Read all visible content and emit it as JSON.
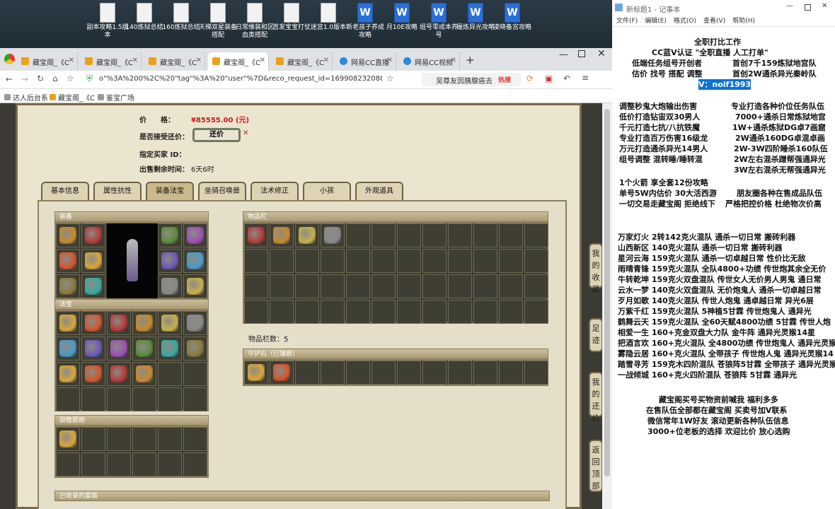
{
  "desktop": {
    "icons": [
      {
        "label": "副本攻略1.5版本",
        "type": "txt"
      },
      {
        "label": "140炼狱总结",
        "type": "txt"
      },
      {
        "label": "160炼狱总结",
        "type": "txt"
      },
      {
        "label": "天梯双星装备搭配",
        "type": "txt"
      },
      {
        "label": "日常维装和区血类搭配",
        "type": "txt"
      },
      {
        "label": "首发宝宝打仗",
        "type": "txt"
      },
      {
        "label": "迷宫1.0版本",
        "type": "txt"
      },
      {
        "label": "新老孩子养成攻略",
        "type": "word"
      },
      {
        "label": "月10E攻略",
        "type": "word"
      },
      {
        "label": "组号零成本养号",
        "type": "word"
      },
      {
        "label": "履炼异光攻略",
        "type": "word"
      },
      {
        "label": "凌晓备宫攻略",
        "type": "word"
      }
    ]
  },
  "browser": {
    "tabs": [
      "藏宝阁_《C",
      "藏宝阁_《C",
      "藏宝阁_《C",
      "藏宝阁_《C",
      "藏宝阁_《C",
      "网易CC直播",
      "网易CC视频"
    ],
    "url": "o\"%3A%200%2C%20\"tag\"%3A%20\"user\"%7D&reco_request_id=1699082320880wCScv",
    "search_text": "吴尊友因胰腺癌去",
    "search_hot": "热搜",
    "bookmarks": [
      "达人后台系",
      "藏宝阁_《C",
      "鉴宝广场"
    ]
  },
  "game": {
    "price_label": "价　　格：",
    "price_value": "¥85555.00 (元)",
    "bargain_label": "是否接受还价：",
    "bargain_button": "还价",
    "buyer_label": "指定买家 ID：",
    "time_label": "出售剩余时间：",
    "time_value": "6天6时",
    "tabs": [
      "基本信息",
      "属性抗性",
      "装备法宝",
      "坐骑召唤兽",
      "法术修正",
      "小孩",
      "外观道具"
    ],
    "equip_title": "装备",
    "fabao_title": "法宝",
    "badge_title": "勋敬层册",
    "bag_title": "物品栏",
    "bag_count": "物品栏数：5",
    "guard_title": "守护石（已镶嵌）",
    "suit_title": "已收录的套装",
    "side_buttons": [
      "我的收藏",
      "足迹",
      "我的还价",
      "返回顶部"
    ]
  },
  "notepad": {
    "title": "新标题1 - 记事本",
    "menu": [
      "文件(F)",
      "编辑(E)",
      "格式(O)",
      "查看(V)",
      "帮助(H)"
    ],
    "lines": [
      {
        "a": "全职打比工作",
        "b": ""
      },
      {
        "a": "CC蓝V认证 \"全职直播 人工打单\"",
        "b": ""
      },
      {
        "a": "低端任务组号开创者",
        "b": "首创7千159炼狱地宫队"
      },
      {
        "a": "估价 找号 搭配 调整",
        "b": "首创2W通杀异光秦岭队"
      },
      {
        "a": "V：noif1993",
        "b": ""
      },
      {
        "a": "调整秒鬼大炮输出伤害",
        "b": "专业打造各种价位任务队伍"
      },
      {
        "a": "低价打造钻宙双30男人",
        "b": "7000+通杀日常炼狱地宫"
      },
      {
        "a": "千元打造七抗/八抗铁魔",
        "b": "1W+通杀炼狱DG卓7画窟"
      },
      {
        "a": "专业打造百万伤害16级龙",
        "b": "2W通杀160DG卓混卓画"
      },
      {
        "a": "万元打造通杀异光14男人",
        "b": "2W-3W四阶睡杀160队伍"
      },
      {
        "a": "组号调整 混转睡/睡转混",
        "b": "2W左右混杀蹭帮强通异光"
      },
      {
        "a": "",
        "b": "3W左右混杀无帮强通异光"
      },
      {
        "a": "1个火箭 享全套12份攻略",
        "b": ""
      },
      {
        "a": "单号5W内估价 30大活西游",
        "b": "朋友圈各种在售成品队伍"
      },
      {
        "a": "一切交易走藏宝阁 拒绝线下",
        "b": "严格把控价格 杜绝物次价高"
      },
      {
        "a": "万家灯火 2转142克火混队 通杀一切日常 搬砖利器",
        "b": ""
      },
      {
        "a": "山西新区 140克火混队 通杀一切日常 搬砖利器",
        "b": ""
      },
      {
        "a": "星河云海 159克火混队 通杀一切卓越日常 性价比无敌",
        "b": ""
      },
      {
        "a": "雨晴青锋 159克火混队 全队4800+功绩 传世炮其余全无价",
        "b": ""
      },
      {
        "a": "牛转乾坤 159克火双盘混队 传世女人无价男人男鬼 通日常",
        "b": ""
      },
      {
        "a": "云水一梦 140克火双盘混队 无价炮鬼人 通杀一切卓越日常",
        "b": ""
      },
      {
        "a": "歹月如歌 140克火混队 传世人炮鬼 通卓越日常 异光6层",
        "b": ""
      },
      {
        "a": "万紫千红 159克火混队 5神植5甘霖 传世炮鬼人 通异光",
        "b": ""
      },
      {
        "a": "鹤舞云天 159克火混队 全60天赋4800功绩 5甘霖 传世人炮",
        "b": ""
      },
      {
        "a": "相爱一生 160+克金双盘大力队 金牛阵 通异光灵猴14星",
        "b": ""
      },
      {
        "a": "把酒言欢 160+克火混队 全4800功绩 传世炮鬼人 通异光灵猴",
        "b": ""
      },
      {
        "a": "雾隐云居 160+克火混队 全带孩子 传世炮人鬼 通异光灵猴14",
        "b": ""
      },
      {
        "a": "踏雪寻芳 159克木四阶混队 苍狼阵5甘霖 全带孩子 通异光灵猴",
        "b": ""
      },
      {
        "a": "一战倾城 160+克火四阶混队 苍狼阵 5甘霖 通异光",
        "b": ""
      },
      {
        "a": "藏宝阁买号买物资前喊我 福利多多",
        "b": ""
      },
      {
        "a": "在售队伍全部都在藏宝阁 买卖号加V联系",
        "b": ""
      },
      {
        "a": "微信常年1W好友 滚动更新各种队伍信息",
        "b": ""
      },
      {
        "a": "3000+位老板的选择 欢迎比价 放心选购",
        "b": ""
      }
    ]
  },
  "colors": {
    "accent": "#0a72d4",
    "price": "#d11a1a"
  }
}
